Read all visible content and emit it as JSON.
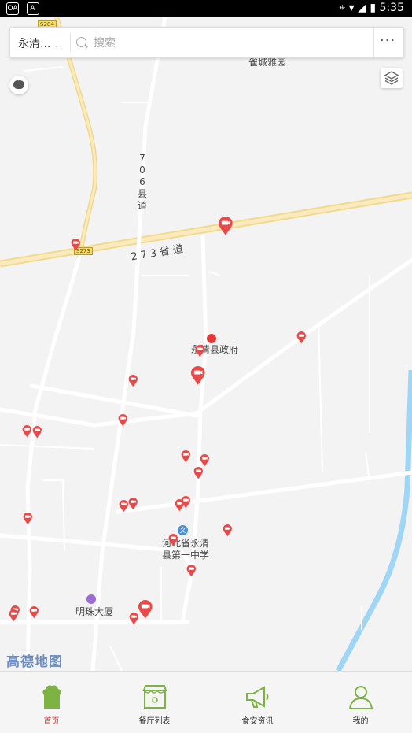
{
  "status_bar": {
    "left_icons": [
      "OA",
      "A"
    ],
    "time": "5:35"
  },
  "search": {
    "city": "永清...",
    "placeholder": "搜索"
  },
  "map": {
    "labels": {
      "gov": "永清县政府",
      "school_line1": "河北省永清",
      "school_line2": "县第一中学",
      "mall": "明珠大厦",
      "top_place": "雀城雅园",
      "provincial_road": "273省道",
      "county_road": "706县道",
      "shield_top": "S284",
      "shield_mid": "S273"
    },
    "logo": "高德地图"
  },
  "tabs": [
    {
      "label": "首页",
      "icon": "chef-hat-icon",
      "active": true
    },
    {
      "label": "餐厅列表",
      "icon": "storefront-icon",
      "active": false
    },
    {
      "label": "食安资讯",
      "icon": "megaphone-icon",
      "active": false
    },
    {
      "label": "我的",
      "icon": "user-icon",
      "active": false
    }
  ],
  "colors": {
    "accent": "#e53935",
    "tab_icon": "#7cb342",
    "road_major": "#f7e3a1",
    "river": "#9fd6f6"
  }
}
